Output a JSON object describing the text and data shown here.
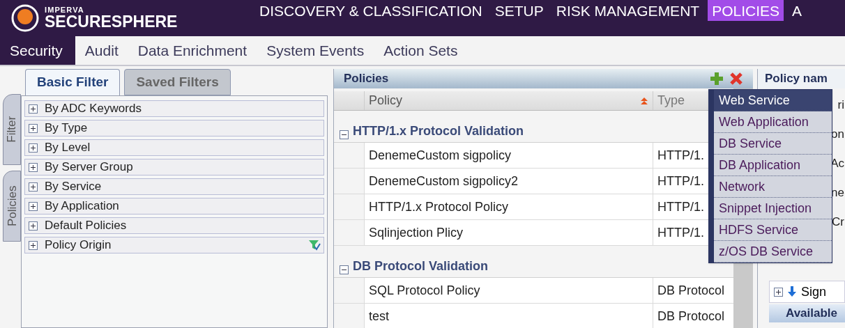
{
  "logo": {
    "brand": "IMPERVA",
    "product": "SECURESPHERE"
  },
  "top_nav": [
    {
      "label": "DISCOVERY & CLASSIFICATION",
      "selected": false
    },
    {
      "label": "SETUP",
      "selected": false
    },
    {
      "label": "RISK MANAGEMENT",
      "selected": false
    },
    {
      "label": "POLICIES",
      "selected": true
    },
    {
      "label": "A",
      "selected": false
    }
  ],
  "sub_nav": [
    {
      "label": "Security",
      "selected": true
    },
    {
      "label": "Audit",
      "selected": false
    },
    {
      "label": "Data Enrichment",
      "selected": false
    },
    {
      "label": "System Events",
      "selected": false
    },
    {
      "label": "Action Sets",
      "selected": false
    }
  ],
  "side_tabs": [
    "Filter",
    "Policies"
  ],
  "filter_tabs": [
    {
      "label": "Basic Filter",
      "selected": true
    },
    {
      "label": "Saved Filters",
      "selected": false
    }
  ],
  "filters": [
    {
      "label": "By ADC Keywords",
      "filtered": false
    },
    {
      "label": "By Type",
      "filtered": false
    },
    {
      "label": "By Level",
      "filtered": false
    },
    {
      "label": "By Server Group",
      "filtered": false
    },
    {
      "label": "By Service",
      "filtered": false
    },
    {
      "label": "By Application",
      "filtered": false
    },
    {
      "label": "Default Policies",
      "filtered": false
    },
    {
      "label": "Policy Origin",
      "filtered": true
    }
  ],
  "policies": {
    "title": "Policies",
    "columns": [
      {
        "label": "Policy",
        "sorted": true
      },
      {
        "label": "Type",
        "sorted": false
      }
    ],
    "groups": [
      {
        "title": "HTTP/1.x Protocol Validation",
        "expanded": true,
        "rows": [
          {
            "policy": "DenemeCustom sigpolicy",
            "type": "HTTP/1."
          },
          {
            "policy": "DenemeCustom sigpolicy2",
            "type": "HTTP/1."
          },
          {
            "policy": "HTTP/1.x Protocol Policy",
            "type": "HTTP/1."
          },
          {
            "policy": "Sqlinjection Plicy",
            "type": "HTTP/1."
          }
        ]
      },
      {
        "title": "DB Protocol Validation",
        "expanded": true,
        "rows": [
          {
            "policy": "SQL Protocol Policy",
            "type": "DB Protocol"
          },
          {
            "policy": "test",
            "type": "DB Protocol"
          }
        ]
      }
    ]
  },
  "add_menu": [
    {
      "label": "Web Service",
      "selected": true
    },
    {
      "label": "Web Application",
      "selected": false
    },
    {
      "label": "DB Service",
      "selected": false
    },
    {
      "label": "DB Application",
      "selected": false
    },
    {
      "label": "Network",
      "selected": false
    },
    {
      "label": "Snippet Injection",
      "selected": false
    },
    {
      "label": "HDFS Service",
      "selected": false
    },
    {
      "label": "z/OS DB Service",
      "selected": false
    }
  ],
  "details": {
    "title": "Policy nam",
    "fragments": [
      "ri",
      "on",
      "Ac",
      "ne",
      "Cr"
    ],
    "section": "Sign",
    "header": "Available"
  }
}
